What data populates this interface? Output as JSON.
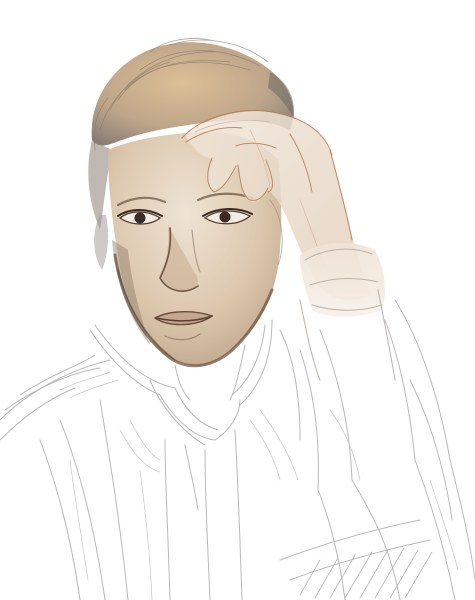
{
  "artwork": {
    "background_color": "#ffffff",
    "colors": {
      "skin": "#e6d2bd",
      "skin_shadow": "#b89f86",
      "hair": "#c9a778",
      "hair_dark": "#8d7a66",
      "outline": "#7a6048",
      "pencil": "#b9b9b9"
    }
  }
}
